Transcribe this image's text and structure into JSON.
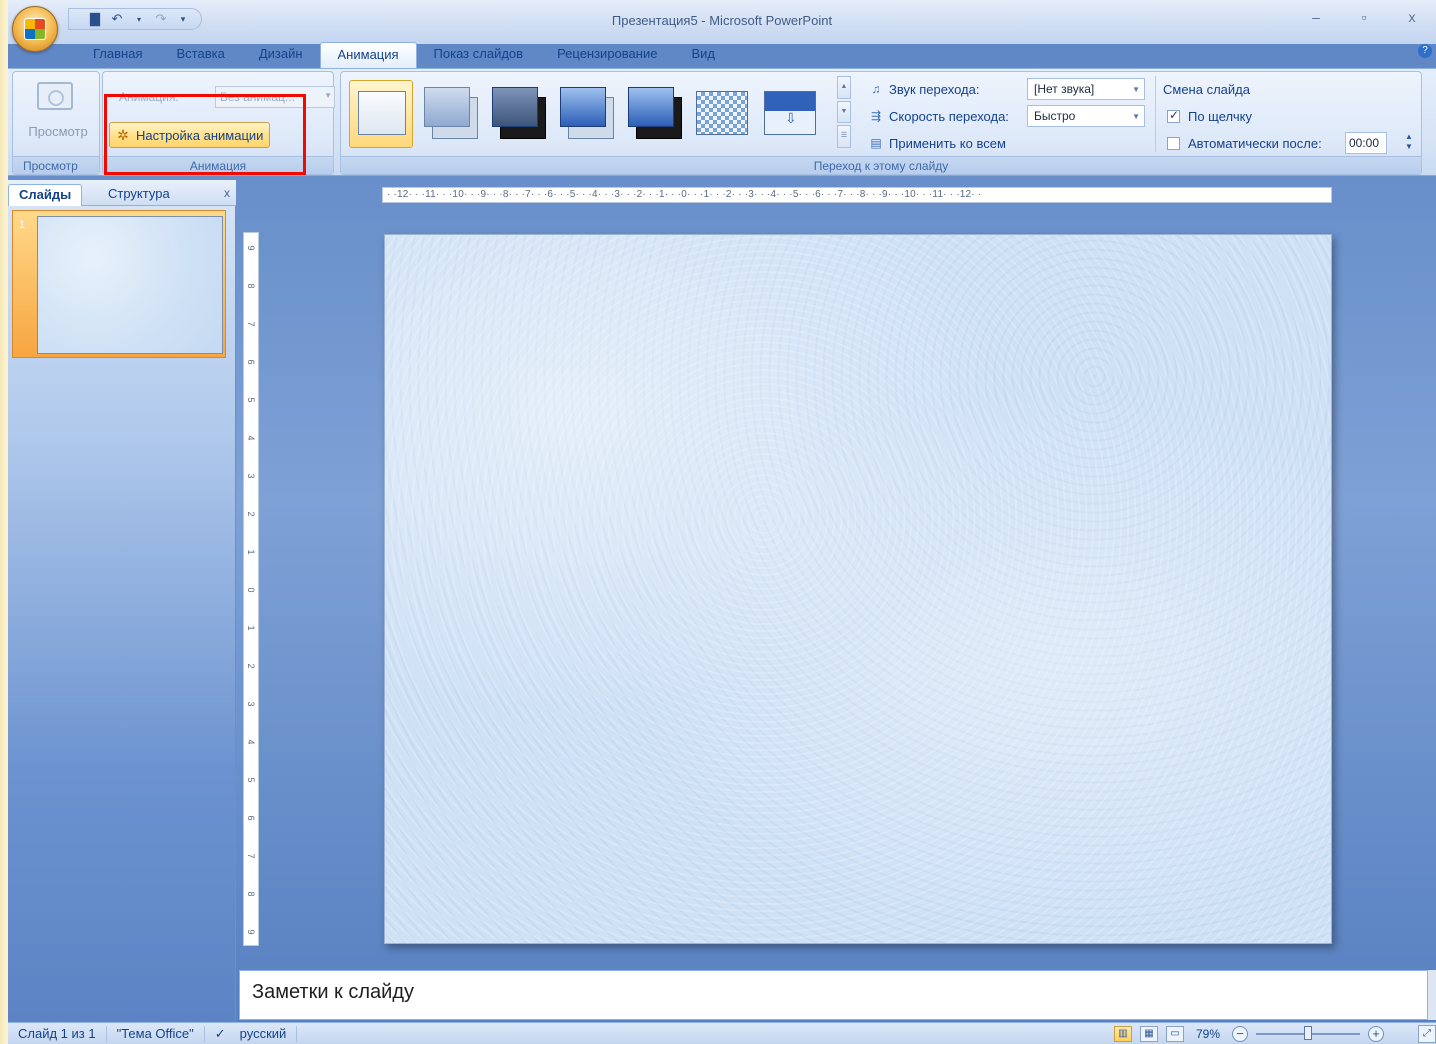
{
  "window": {
    "title": "Презентация5 - Microsoft PowerPoint",
    "minimize": "–",
    "restore": "▫",
    "close": "x"
  },
  "qat": {
    "save_icon": "save-icon",
    "undo_icon": "undo-icon",
    "redo_icon": "redo-icon"
  },
  "tabs": [
    "Главная",
    "Вставка",
    "Дизайн",
    "Анимация",
    "Показ слайдов",
    "Рецензирование",
    "Вид"
  ],
  "active_tab": "Анимация",
  "ribbon": {
    "preview": {
      "button_label": "Просмотр",
      "group_label": "Просмотр"
    },
    "animation": {
      "animate_label": "Анимация:",
      "animate_value": "Без анимац...",
      "custom_label": "Настройка анимации",
      "group_label": "Анимация"
    },
    "transition": {
      "sound_label": "Звук перехода:",
      "sound_value": "[Нет звука]",
      "speed_label": "Скорость перехода:",
      "speed_value": "Быстро",
      "apply_all_label": "Применить ко всем",
      "group_label": "Переход к этому слайду"
    },
    "advance": {
      "header": "Смена слайда",
      "on_click_label": "По щелчку",
      "on_click_checked": true,
      "auto_label": "Автоматически после:",
      "auto_checked": false,
      "auto_value": "00:00"
    }
  },
  "panel": {
    "tab_slides": "Слайды",
    "tab_outline": "Структура",
    "close": "x",
    "slide_number": "1"
  },
  "ruler": {
    "h_ticks": "· ·12· · ·11· · ·10· · ·9· · ·8· · ·7· · ·6· · ·5· · ·4· · ·3· · ·2· · ·1· · ·0· · ·1· · ·2· · ·3· · ·4· · ·5· · ·6· · ·7· · ·8· · ·9· · ·10· · ·11· · ·12· ·"
  },
  "notes": {
    "placeholder": "Заметки к слайду"
  },
  "status": {
    "slide_info": "Слайд 1 из 1",
    "theme": "\"Тема Office\"",
    "language": "русский",
    "zoom": "79%"
  },
  "colors": {
    "highlight": "#f00a00",
    "accent": "#15428b",
    "slide_bg": "#cfe1f5"
  }
}
